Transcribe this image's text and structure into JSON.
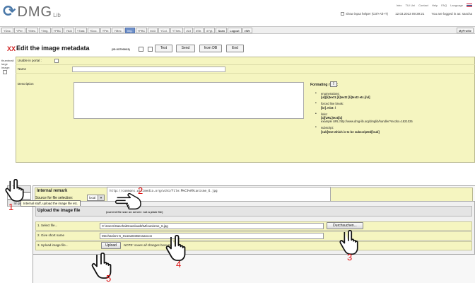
{
  "header": {
    "logo_main": "DMG",
    "logo_sub": "Lib",
    "top_links": [
      "Intro",
      "TU/ Uni",
      "Contact",
      "Help",
      "FAQ",
      "Language"
    ],
    "input_helper_label": "show input helper (Ctrl+Alt+T)",
    "datetime": "12.03.2013 09:39:21",
    "login_text": "You are logged in as: sascha"
  },
  "nav": {
    "tabs": [
      "YDoc.",
      "YPer.",
      "YMec.",
      "YImg.",
      "YPBC",
      "YAI3",
      "YTask",
      "YDoc.",
      "YPer.",
      "YMec.",
      "Img.",
      "YPBC",
      "MJ3",
      "YCol.",
      "YThes.",
      "#Lit",
      "#Str.",
      "#Ygt.",
      "Scan",
      "Logout",
      "eWe"
    ],
    "right": "MyProfile"
  },
  "title": {
    "marker": "XX",
    "text": "Edit the image metadata",
    "id": "(ID:33790023)",
    "buttons": {
      "test": "Test",
      "send": "Send",
      "fromdb": "from DB",
      "end": "End"
    }
  },
  "thumbnail": {
    "label": "thumbnail\nlarge\nimage:"
  },
  "form": {
    "usable_label": "Usable in portal :",
    "name_label": "Name",
    "description_label": "Description",
    "formating_label": "Formating rules:",
    "formating_btn": "!",
    "rules": [
      {
        "title": "enumerations:",
        "text": "[ul][li]text1 [li]text2 [li]text3 etc.[/ul]"
      },
      {
        "title": "forced line break:",
        "text": "[br]. Hint: \\"
      },
      {
        "title": "links:",
        "text": "[a][URL]text[/a]",
        "example": "example URL:http://www.dmg-lib.org/dmglib/handler?mcdsc=1821025"
      },
      {
        "title": "subscript:",
        "text": "[sub]text which is to be subscripted[/sub]"
      }
    ]
  },
  "sidetabs": [
    "Main",
    "Intern",
    "Im prov"
  ],
  "remark": {
    "label": "Internal remark",
    "value": "http://commons.wikimedia.org/wiki/File:M%C3%A9canisme_6.jpg"
  },
  "tooltip": "Internal stuff, upload the image file etc.",
  "source": {
    "label": "Source for file selection:",
    "value": "local"
  },
  "upload": {
    "title": "Upload the image file",
    "note": "(current file size on server: not a plain file)",
    "rows": [
      {
        "label": "1. Select file...",
        "value": "C:\\Users\\Sascha\\Downloads\\Mécanisme_6.jpg",
        "button": "Durchsuchen..."
      },
      {
        "label": "2. Give short name",
        "value": "Mechanism-6_SUeanDeBessancon"
      },
      {
        "label": "3. Upload image file...",
        "button": "Upload",
        "note": "NOTE: saves all changes here too!"
      }
    ]
  },
  "callouts": [
    "1",
    "2",
    "3",
    "4",
    "5"
  ]
}
